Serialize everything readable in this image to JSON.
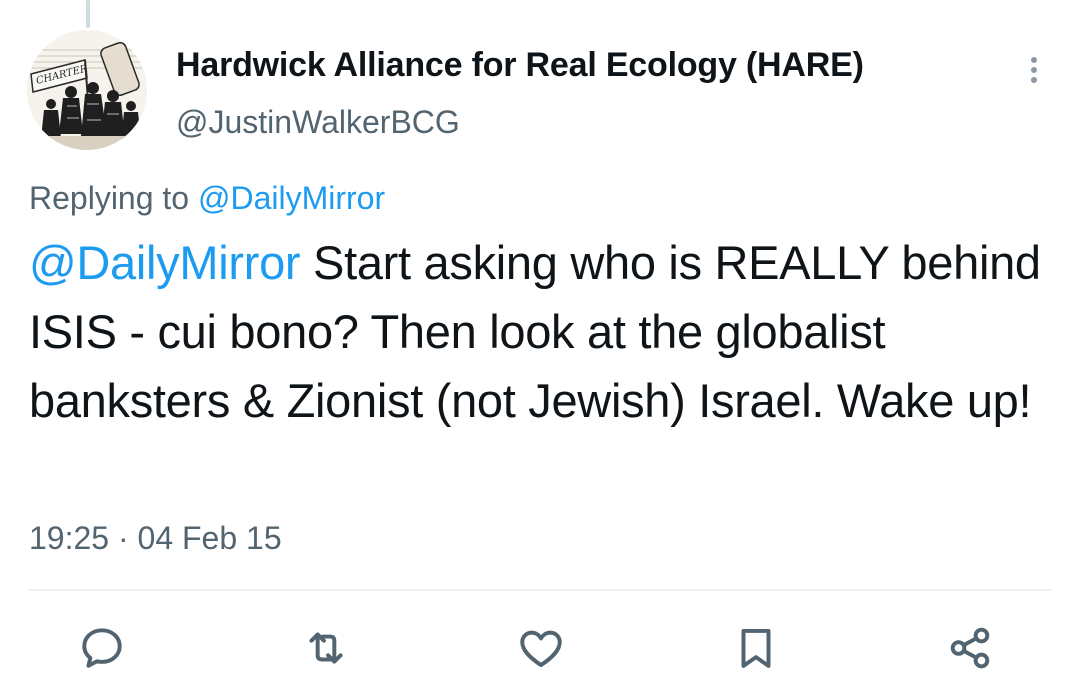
{
  "tweet": {
    "display_name": "Hardwick Alliance for Real Ecology (HARE)",
    "handle": "@JustinWalkerBCG",
    "avatar_banner_text": "CHARTER",
    "replying_to_prefix": "Replying to",
    "replying_to_handle": "@DailyMirror",
    "text_mention": "@DailyMirror",
    "text_body": " Start asking who is REALLY behind ISIS - cui bono? Then look at the globalist banksters & Zionist (not Jewish) Israel. Wake up!",
    "timestamp": "19:25 · 04 Feb 15"
  },
  "actions": [
    {
      "name": "reply",
      "icon": "speech-bubble-icon"
    },
    {
      "name": "retweet",
      "icon": "retweet-icon"
    },
    {
      "name": "like",
      "icon": "heart-icon"
    },
    {
      "name": "bookmark",
      "icon": "bookmark-icon"
    },
    {
      "name": "share",
      "icon": "share-icon"
    }
  ],
  "colors": {
    "text": "#0f1419",
    "secondary_text": "#536471",
    "link": "#1d9bf0",
    "divider": "#eff3f4"
  }
}
